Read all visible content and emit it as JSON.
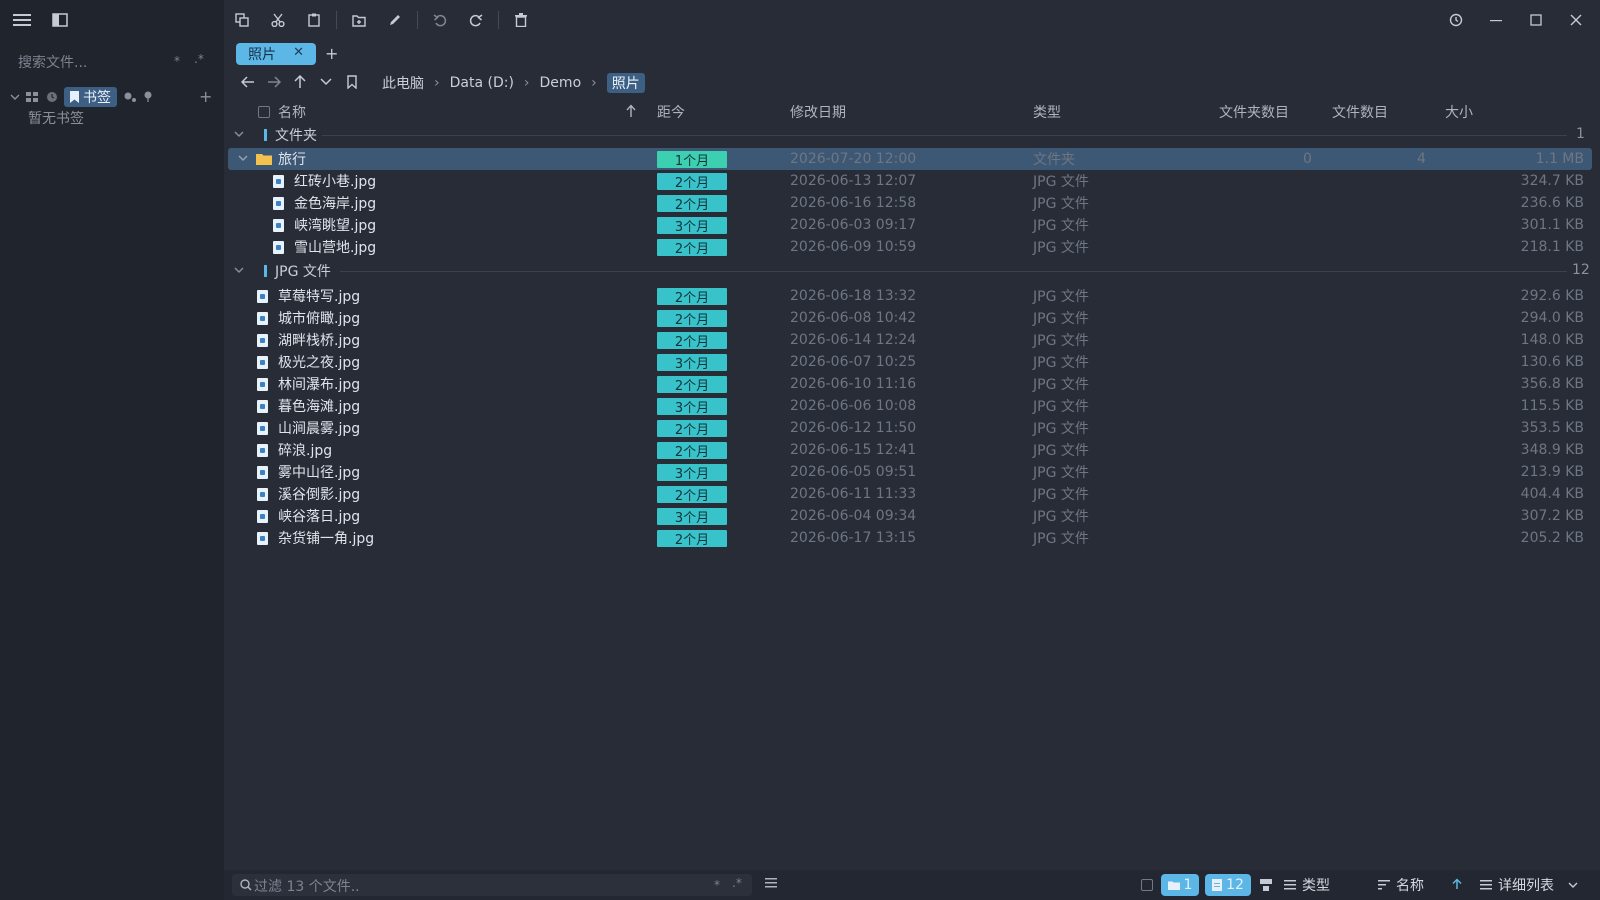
{
  "sidebar": {
    "search_placeholder": "搜索文件...",
    "search_opt_star": "*",
    "search_opt_regex": ".*",
    "bookmarks_label": "书签",
    "empty_label": "暂无书签",
    "add": "+"
  },
  "tabs": [
    {
      "label": "照片",
      "close": "✕"
    }
  ],
  "new_tab": "+",
  "breadcrumbs": [
    "此电脑",
    "Data (D:)",
    "Demo",
    "照片"
  ],
  "columns": {
    "name": "名称",
    "age": "距今",
    "modified": "修改日期",
    "type": "类型",
    "folder_count": "文件夹数目",
    "file_count": "文件数目",
    "size": "大小"
  },
  "groups": [
    {
      "label": "文件夹",
      "count": "1"
    },
    {
      "label": "JPG 文件",
      "count": "12"
    }
  ],
  "folder_row": {
    "name": "旅行",
    "age": "1个月",
    "modified": "2026-07-20 12:00",
    "type": "文件夹",
    "folders": "0",
    "files": "4",
    "size": "1.1 MB"
  },
  "folder_children": [
    {
      "name": "红砖小巷.jpg",
      "age": "2个月",
      "modified": "2026-06-13 12:07",
      "type": "JPG 文件",
      "size": "324.7 KB"
    },
    {
      "name": "金色海岸.jpg",
      "age": "2个月",
      "modified": "2026-06-16 12:58",
      "type": "JPG 文件",
      "size": "236.6 KB"
    },
    {
      "name": "峡湾眺望.jpg",
      "age": "3个月",
      "modified": "2026-06-03 09:17",
      "type": "JPG 文件",
      "size": "301.1 KB"
    },
    {
      "name": "雪山营地.jpg",
      "age": "2个月",
      "modified": "2026-06-09 10:59",
      "type": "JPG 文件",
      "size": "218.1 KB"
    }
  ],
  "files": [
    {
      "name": "草莓特写.jpg",
      "age": "2个月",
      "modified": "2026-06-18 13:32",
      "type": "JPG 文件",
      "size": "292.6 KB"
    },
    {
      "name": "城市俯瞰.jpg",
      "age": "2个月",
      "modified": "2026-06-08 10:42",
      "type": "JPG 文件",
      "size": "294.0 KB"
    },
    {
      "name": "湖畔栈桥.jpg",
      "age": "2个月",
      "modified": "2026-06-14 12:24",
      "type": "JPG 文件",
      "size": "148.0 KB"
    },
    {
      "name": "极光之夜.jpg",
      "age": "3个月",
      "modified": "2026-06-07 10:25",
      "type": "JPG 文件",
      "size": "130.6 KB"
    },
    {
      "name": "林间瀑布.jpg",
      "age": "2个月",
      "modified": "2026-06-10 11:16",
      "type": "JPG 文件",
      "size": "356.8 KB"
    },
    {
      "name": "暮色海滩.jpg",
      "age": "3个月",
      "modified": "2026-06-06 10:08",
      "type": "JPG 文件",
      "size": "115.5 KB"
    },
    {
      "name": "山涧晨雾.jpg",
      "age": "2个月",
      "modified": "2026-06-12 11:50",
      "type": "JPG 文件",
      "size": "353.5 KB"
    },
    {
      "name": "碎浪.jpg",
      "age": "2个月",
      "modified": "2026-06-15 12:41",
      "type": "JPG 文件",
      "size": "348.9 KB"
    },
    {
      "name": "雾中山径.jpg",
      "age": "3个月",
      "modified": "2026-06-05 09:51",
      "type": "JPG 文件",
      "size": "213.9 KB"
    },
    {
      "name": "溪谷倒影.jpg",
      "age": "2个月",
      "modified": "2026-06-11 11:33",
      "type": "JPG 文件",
      "size": "404.4 KB"
    },
    {
      "name": "峡谷落日.jpg",
      "age": "3个月",
      "modified": "2026-06-04 09:34",
      "type": "JPG 文件",
      "size": "307.2 KB"
    },
    {
      "name": "杂货铺一角.jpg",
      "age": "2个月",
      "modified": "2026-06-17 13:15",
      "type": "JPG 文件",
      "size": "205.2 KB"
    }
  ],
  "statusbar": {
    "filter_placeholder": "过滤 13 个文件..",
    "filter_opt_star": "*",
    "filter_opt_regex": ".*",
    "folders_count": "1",
    "files_count": "12",
    "group_by": "类型",
    "sort_by": "名称",
    "view_mode": "详细列表"
  },
  "colors": {
    "accent": "#5cb6e6",
    "age_badge": "#38c3cb",
    "age_badge_recent": "#3ccfb0",
    "selection": "#3d5875"
  }
}
